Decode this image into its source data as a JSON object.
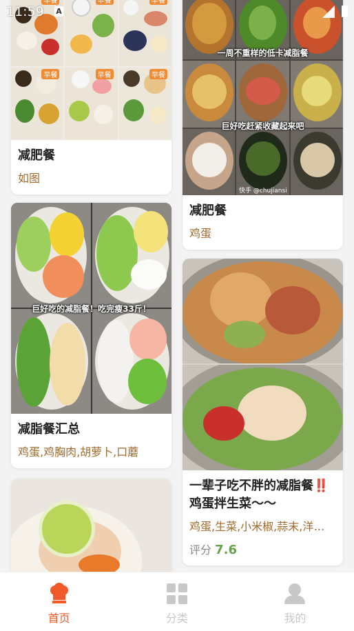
{
  "status_bar": {
    "time": "11:59"
  },
  "image_text": {
    "breakfast": "早餐",
    "banner_week": "一周不重样的低卡减脂餐",
    "banner_save": "巨好吃赶紧收藏起来吧",
    "banner_tasty": "巨好吃的减脂餐！吃完瘦33斤！",
    "watermark": "快手 @chujiansi"
  },
  "feed": {
    "left": [
      {
        "title": "减肥餐",
        "ingredients": "如图"
      },
      {
        "title": "减脂餐汇总",
        "ingredients": "鸡蛋,鸡胸肉,胡萝卜,口蘑"
      },
      {
        "title": "",
        "ingredients": ""
      }
    ],
    "right": [
      {
        "title": "减肥餐",
        "ingredients": "鸡蛋"
      },
      {
        "title_line1": "一辈子吃不胖的减脂餐",
        "title_mark": "‼️",
        "title_line2": "鸡蛋拌生菜～～",
        "ingredients": "鸡蛋,生菜,小米椒,蒜末,洋…",
        "rating_label": "评分",
        "rating_value": "7.6"
      }
    ]
  },
  "tabbar": {
    "items": [
      {
        "label": "首页",
        "icon": "chef-hat-icon",
        "active": true
      },
      {
        "label": "分类",
        "icon": "grid-icon",
        "active": false
      },
      {
        "label": "我的",
        "icon": "person-icon",
        "active": false
      }
    ]
  },
  "colors": {
    "accent": "#f05a2a",
    "ingredient_text": "#a06a2c",
    "rating": "#67a34a"
  }
}
